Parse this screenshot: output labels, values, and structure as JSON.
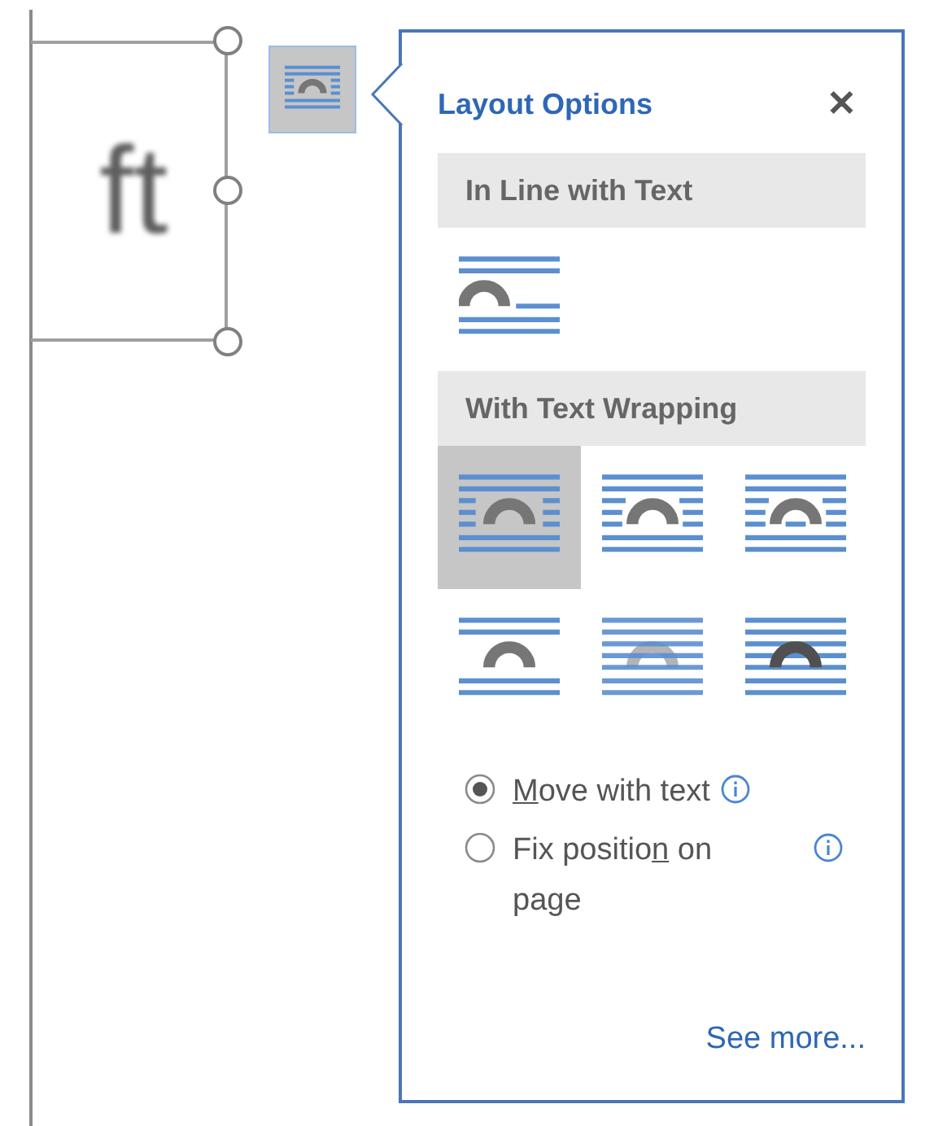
{
  "document": {
    "text_fragment": "ft"
  },
  "layout_button": {
    "selected": true
  },
  "panel": {
    "title": "Layout Options",
    "close": "✕",
    "sections": [
      {
        "heading": "In Line with Text",
        "options": [
          {
            "kind": "inline",
            "selected": false
          }
        ]
      },
      {
        "heading": "With Text Wrapping",
        "options": [
          {
            "kind": "square",
            "selected": true
          },
          {
            "kind": "tight",
            "selected": false
          },
          {
            "kind": "through",
            "selected": false
          },
          {
            "kind": "topbottom",
            "selected": false
          },
          {
            "kind": "behind",
            "selected": false
          },
          {
            "kind": "front",
            "selected": false
          }
        ]
      }
    ],
    "positions": [
      {
        "access_key": "M",
        "text_after": "ove with text",
        "selected": true
      },
      {
        "text_before": "Fix positio",
        "access_key": "n",
        "text_after": " on page",
        "selected": false
      }
    ],
    "see_more": "See more..."
  }
}
